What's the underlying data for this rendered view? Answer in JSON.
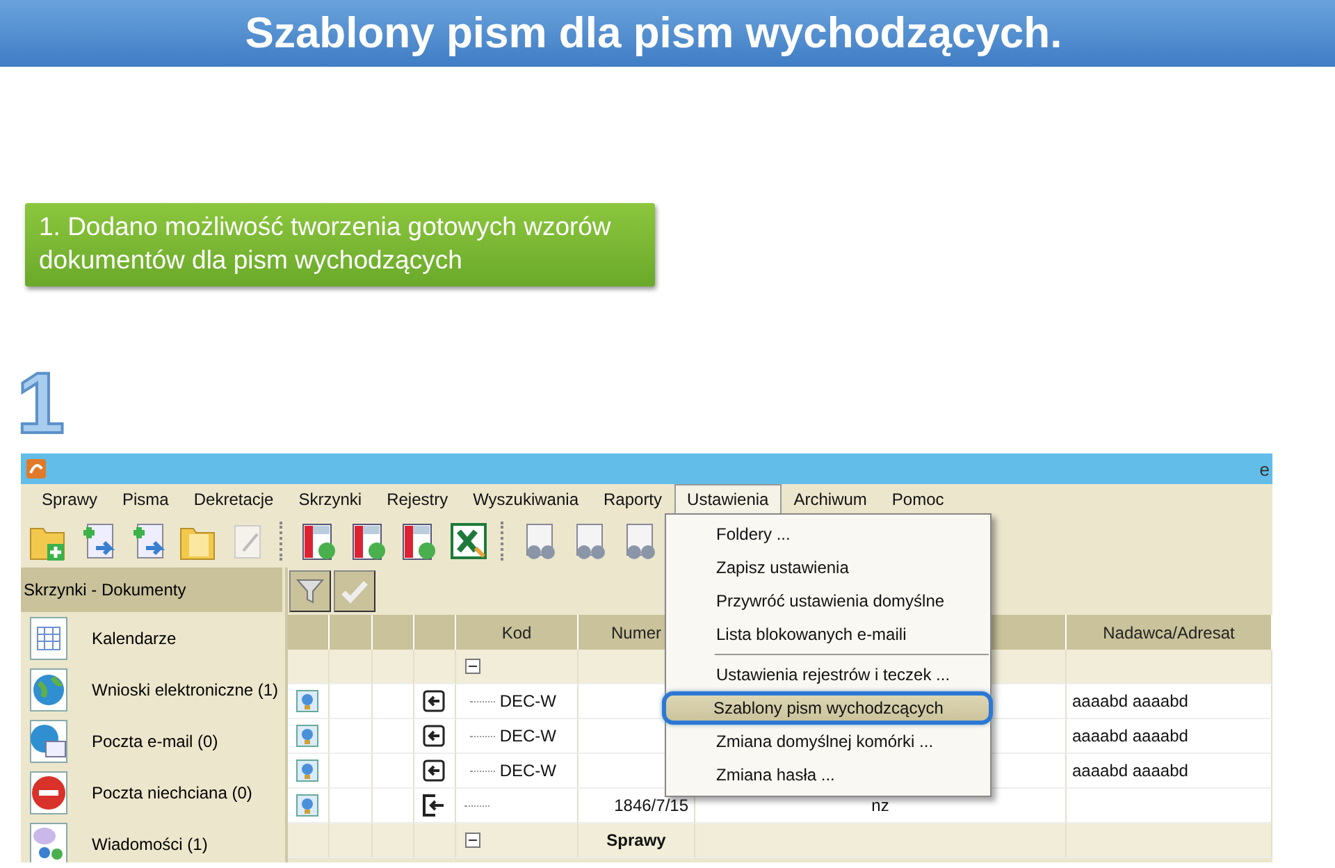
{
  "slide": {
    "title": "Szablony pism dla pism wychodzących.",
    "callout": "1. Dodano możliwość tworzenia gotowych wzorów dokumentów dla pism wychodzących",
    "step": "1"
  },
  "app": {
    "title_fragment": "e",
    "menu": [
      {
        "label": "Sprawy",
        "open": false
      },
      {
        "label": "Pisma",
        "open": false
      },
      {
        "label": "Dekretacje",
        "open": false
      },
      {
        "label": "Skrzynki",
        "open": false
      },
      {
        "label": "Rejestry",
        "open": false
      },
      {
        "label": "Wyszukiwania",
        "open": false
      },
      {
        "label": "Raporty",
        "open": false
      },
      {
        "label": "Ustawienia",
        "open": true
      },
      {
        "label": "Archiwum",
        "open": false
      },
      {
        "label": "Pomoc",
        "open": false
      }
    ],
    "sidebar": {
      "header": "Skrzynki - Dokumenty",
      "items": [
        {
          "label": "Kalendarze",
          "kind": "calendar"
        },
        {
          "label": "Wnioski elektroniczne (1)",
          "kind": "globe"
        },
        {
          "label": "Poczta e-mail (0)",
          "kind": "mail"
        },
        {
          "label": "Poczta niechciana (0)",
          "kind": "blocked"
        },
        {
          "label": "Wiadomości (1)",
          "kind": "messages"
        }
      ]
    },
    "table": {
      "columns": [
        {},
        {},
        {},
        {},
        {
          "label": "Kod"
        },
        {
          "label": "Numer"
        },
        {},
        {
          "label": "Nadawca/Adresat"
        }
      ],
      "rows": [
        {
          "kind": "group"
        },
        {
          "kind": "incoming",
          "kod": "DEC-W",
          "sender": "aaaabd aaaabd"
        },
        {
          "kind": "incoming",
          "kod": "DEC-W",
          "sender": "aaaabd aaaabd"
        },
        {
          "kind": "incoming",
          "kod": "DEC-W",
          "sender": "aaaabd aaaabd"
        },
        {
          "kind": "outgoing",
          "number": "1846/7/15",
          "column_7": "nz"
        },
        {
          "kind": "group",
          "label": "Sprawy"
        }
      ]
    },
    "dropdown": [
      {
        "label": "Foldery ...",
        "selected": false,
        "separator_before": false
      },
      {
        "label": "Zapisz ustawienia",
        "selected": false,
        "separator_before": false
      },
      {
        "label": "Przywróć ustawienia domyślne",
        "selected": false,
        "separator_before": false
      },
      {
        "label": "Lista blokowanych e-maili",
        "selected": false,
        "separator_before": false
      },
      {
        "label": "Ustawienia rejestrów i teczek ...",
        "selected": false,
        "separator_before": true
      },
      {
        "label": "Szablony pism wychodzcących",
        "selected": true,
        "separator_before": false
      },
      {
        "label": "Zmiana domyślnej komórki ...",
        "selected": false,
        "separator_before": false
      },
      {
        "label": "Zmiana hasła ...",
        "selected": false,
        "separator_before": false
      }
    ]
  }
}
